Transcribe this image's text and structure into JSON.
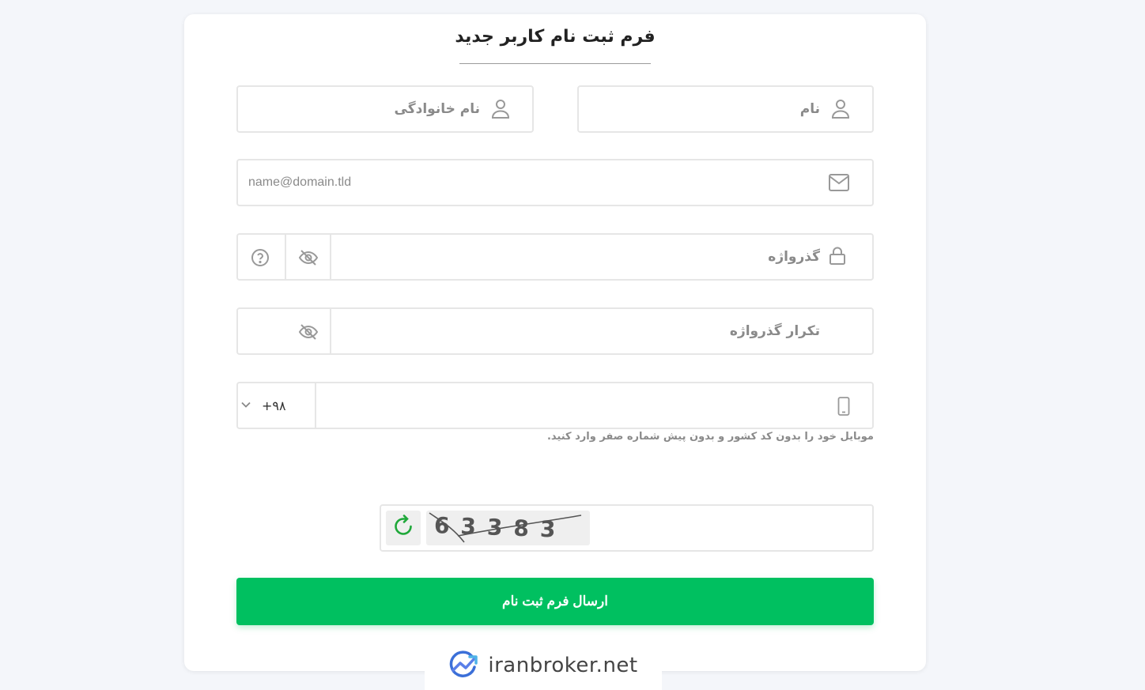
{
  "form": {
    "title": "فرم ثبت نام کاربر جدید",
    "first_name": {
      "placeholder": "نام",
      "icon": "user-icon"
    },
    "last_name": {
      "placeholder": "نام خانوادگی",
      "icon": "user-icon"
    },
    "email": {
      "placeholder": "name@domain.tld",
      "icon": "mail-icon"
    },
    "password": {
      "placeholder": "گذرواژه",
      "icon": "lock-icon",
      "toggle_icon": "eye-off-icon",
      "help_icon": "question-circle-icon"
    },
    "password_repeat": {
      "placeholder": "تکرار گذرواژه",
      "toggle_icon": "eye-off-icon"
    },
    "mobile": {
      "country_code": "+۹۸",
      "icon": "mobile-phone-icon",
      "dropdown_icon": "chevron-down-icon",
      "hint": "موبایل خود را بدون کد کشور و بدون پیش شماره صفر وارد کنید."
    },
    "captcha": {
      "code": "63383",
      "refresh_icon": "refresh-icon"
    },
    "submit_label": "ارسال فرم ثبت نام"
  },
  "brand": {
    "name": "iranbroker.net",
    "icon": "chart-logo-icon"
  },
  "colors": {
    "accent": "#00c060",
    "border": "#e6e6e6",
    "placeholder": "#8a8a8a",
    "background": "#f4f6fa",
    "refresh": "#1fa83a"
  }
}
